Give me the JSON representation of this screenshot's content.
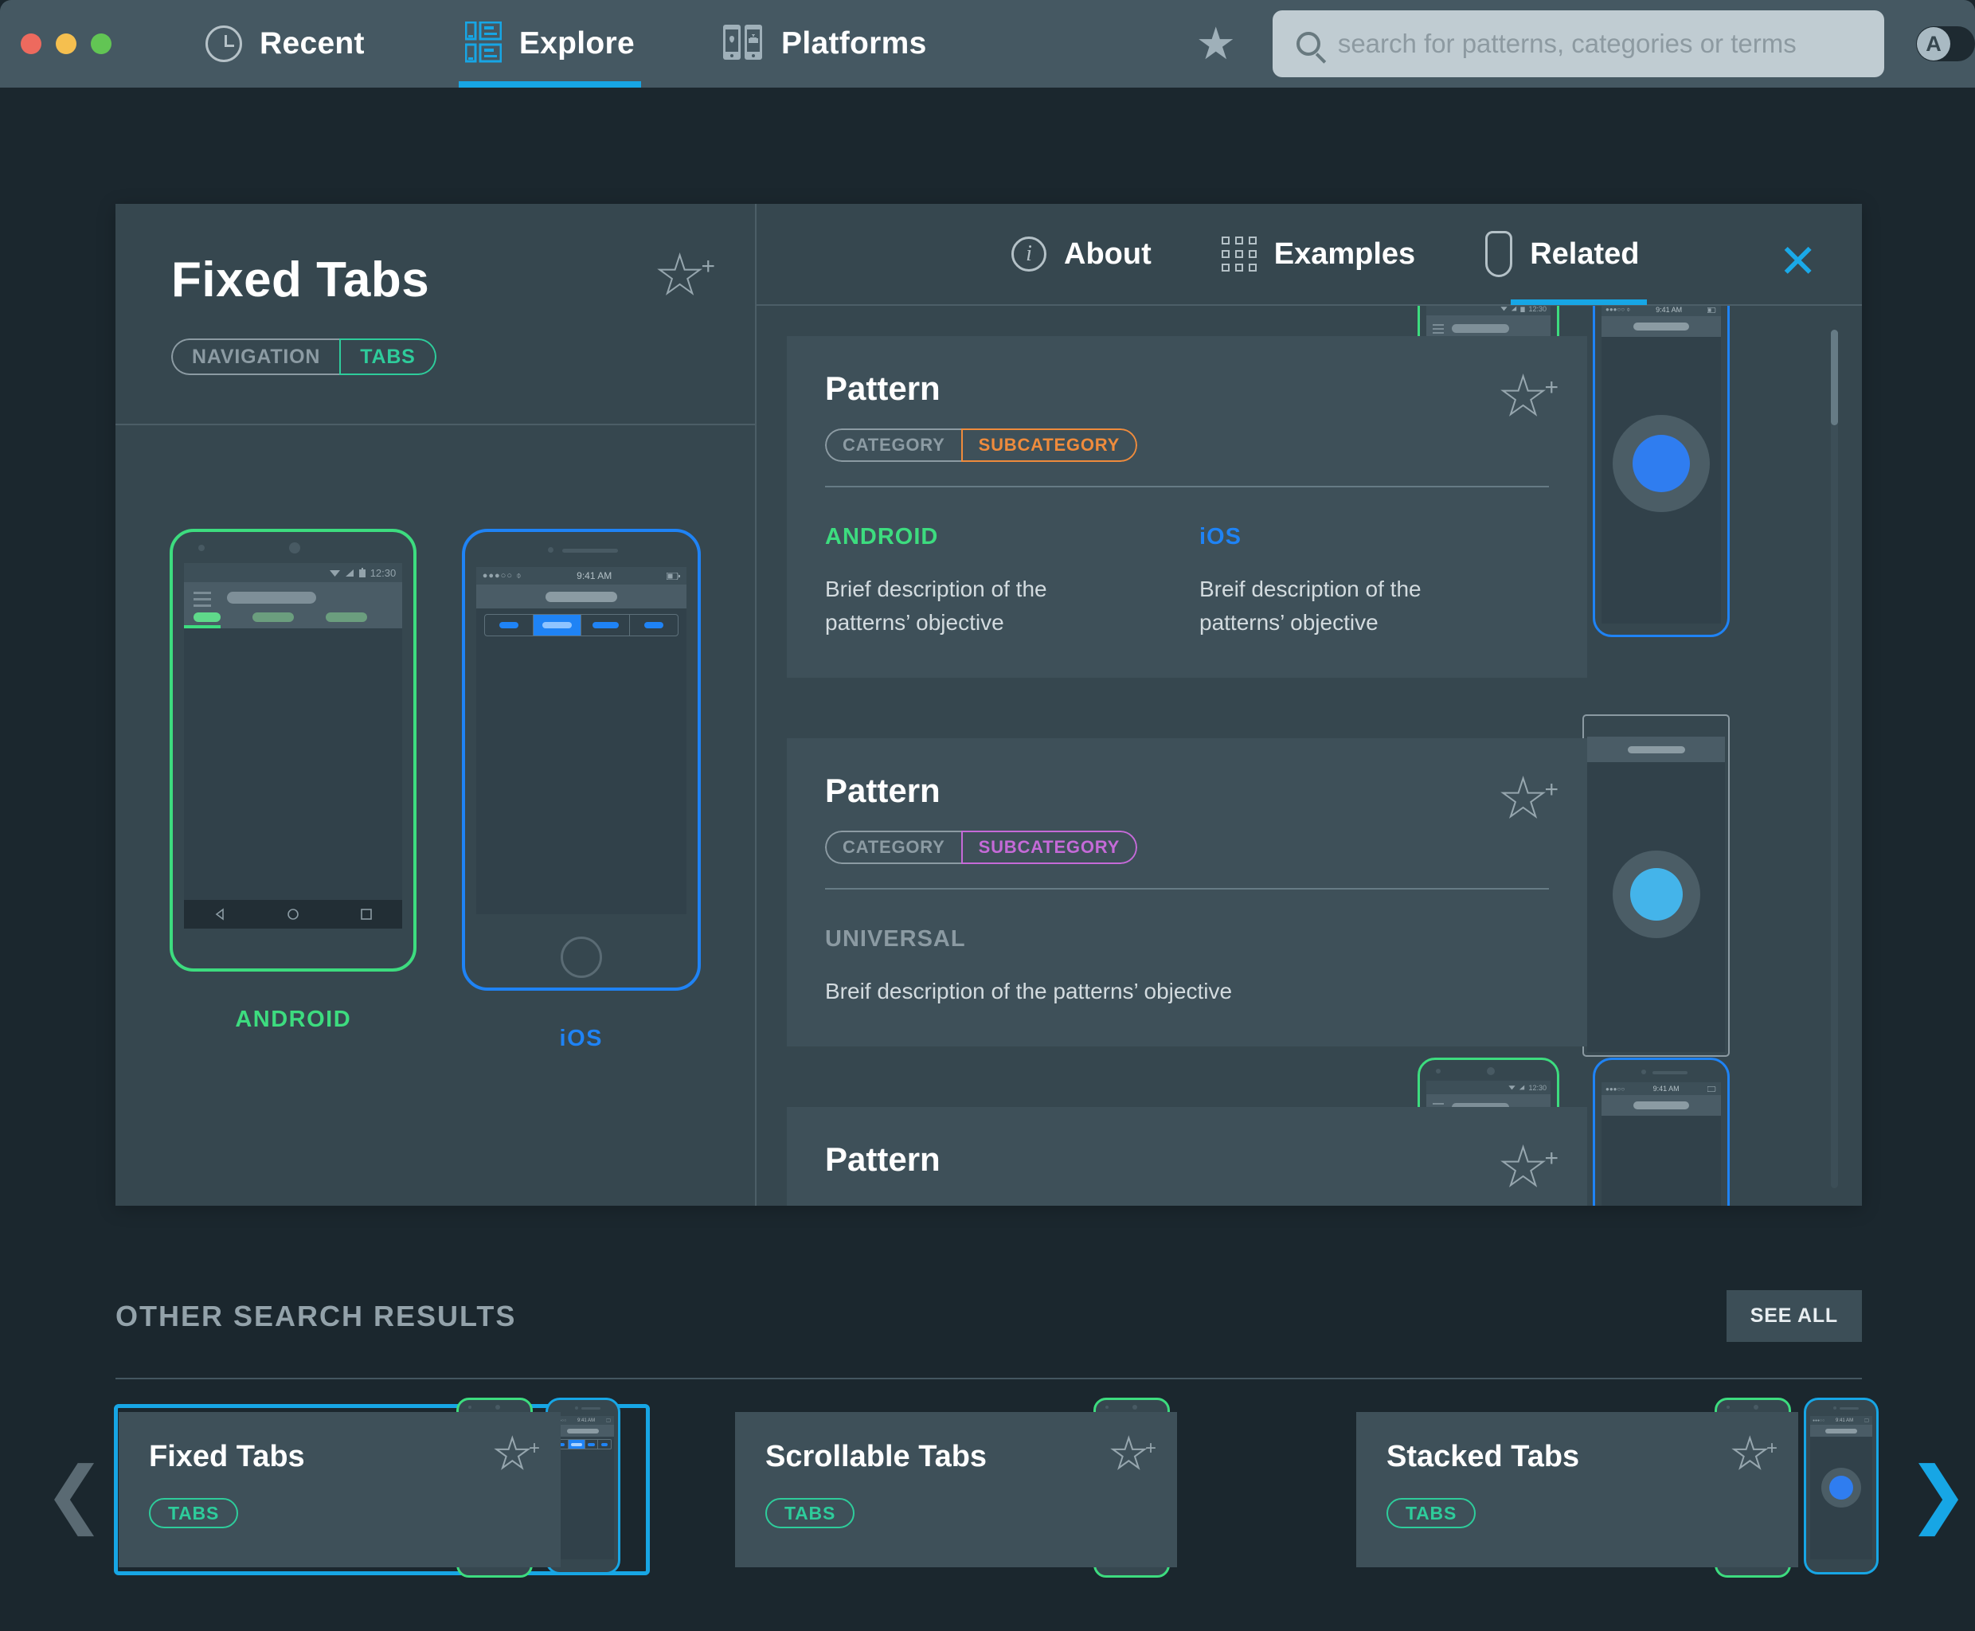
{
  "topbar": {
    "nav": [
      {
        "label": "Recent",
        "icon": "clock-icon",
        "active": false
      },
      {
        "label": "Explore",
        "icon": "explore-grid-icon",
        "active": true
      },
      {
        "label": "Platforms",
        "icon": "platforms-devices-icon",
        "active": false
      }
    ],
    "favorites_icon": "star-filled-icon",
    "search": {
      "value": "",
      "placeholder": "search for patterns, categories or terms",
      "icon": "search-icon"
    },
    "account": {
      "initial": "A",
      "toggle_state": "on"
    }
  },
  "detail": {
    "title": "Fixed Tabs",
    "favorite_icon": "star-add-icon",
    "tags": {
      "category": "NAVIGATION",
      "subcategory": "TABS"
    },
    "platforms": [
      {
        "label": "ANDROID",
        "color": "#3ddc7f",
        "status_time": "12:30"
      },
      {
        "label": "iOS",
        "color": "#1f83f5",
        "status_time": "9:41 AM"
      }
    ],
    "tabs": [
      {
        "label": "About",
        "icon": "info-icon",
        "active": false
      },
      {
        "label": "Examples",
        "icon": "grid-icon",
        "active": false
      },
      {
        "label": "Related",
        "icon": "device-icon",
        "active": true
      }
    ],
    "close_icon": "close-icon"
  },
  "related": [
    {
      "title": "Pattern",
      "category": "CATEGORY",
      "subcategory": "SUBCATEGORY",
      "subcategory_color": "#ef8b3c",
      "favorite_icon": "star-add-icon",
      "blocks": [
        {
          "platform": "ANDROID",
          "color": "#3ddc7f",
          "description": "Brief description of the patterns’ objective"
        },
        {
          "platform": "iOS",
          "color": "#1f83f5",
          "description": "Breif description of the patterns’ objective"
        }
      ],
      "previews": [
        "android-phone",
        "ios-phone"
      ]
    },
    {
      "title": "Pattern",
      "category": "CATEGORY",
      "subcategory": "SUBCATEGORY",
      "subcategory_color": "#c56ad8",
      "favorite_icon": "star-add-icon",
      "blocks": [
        {
          "platform": "UNIVERSAL",
          "color": "#8b9aa2",
          "description": "Breif description of the patterns’ objective"
        }
      ],
      "previews": [
        "universal-tablet"
      ]
    },
    {
      "title": "Pattern",
      "category": "",
      "subcategory": "",
      "subcategory_color": "",
      "favorite_icon": "star-add-icon",
      "blocks": [],
      "previews": [
        "android-phone",
        "ios-phone"
      ]
    }
  ],
  "other_results": {
    "heading": "OTHER SEARCH RESULTS",
    "see_all_label": "SEE ALL",
    "prev_icon": "chevron-left-icon",
    "next_icon": "chevron-right-icon",
    "items": [
      {
        "title": "Fixed Tabs",
        "tag": "TABS",
        "selected": true,
        "favorite_icon": "star-add-icon",
        "thumbs": [
          "android",
          "ios"
        ]
      },
      {
        "title": "Scrollable Tabs",
        "tag": "TABS",
        "selected": false,
        "favorite_icon": "star-add-icon",
        "thumbs": [
          "android"
        ]
      },
      {
        "title": "Stacked Tabs",
        "tag": "TABS",
        "selected": false,
        "favorite_icon": "star-add-icon",
        "thumbs": [
          "android",
          "ios"
        ]
      }
    ]
  },
  "colors": {
    "accent_blue": "#17a6e5",
    "android_green": "#3ddc7f",
    "ios_blue": "#1f83f5",
    "tag_teal": "#2ecc9b",
    "orange": "#ef8b3c",
    "purple": "#c56ad8",
    "panel": "#36474f",
    "card": "#3e5059",
    "background": "#1b272e",
    "topbar": "#455862"
  }
}
